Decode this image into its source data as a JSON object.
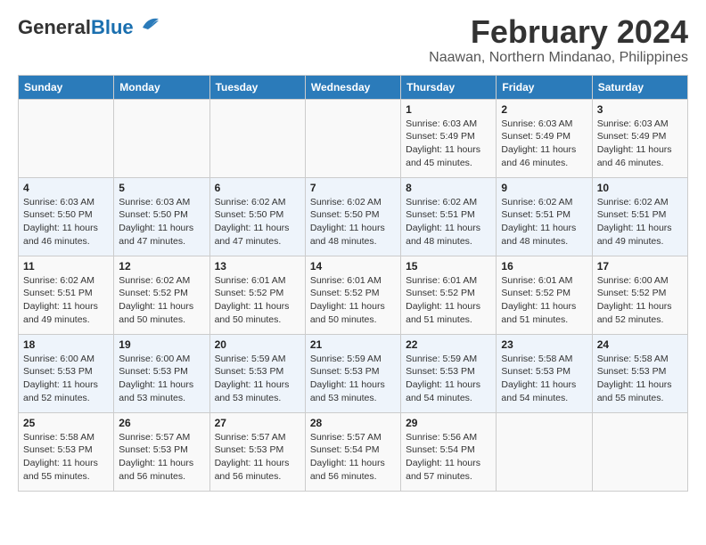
{
  "header": {
    "logo_general": "General",
    "logo_blue": "Blue",
    "month_title": "February 2024",
    "location": "Naawan, Northern Mindanao, Philippines"
  },
  "days_of_week": [
    "Sunday",
    "Monday",
    "Tuesday",
    "Wednesday",
    "Thursday",
    "Friday",
    "Saturday"
  ],
  "weeks": [
    [
      {
        "day": "",
        "info": ""
      },
      {
        "day": "",
        "info": ""
      },
      {
        "day": "",
        "info": ""
      },
      {
        "day": "",
        "info": ""
      },
      {
        "day": "1",
        "info": "Sunrise: 6:03 AM\nSunset: 5:49 PM\nDaylight: 11 hours and 45 minutes."
      },
      {
        "day": "2",
        "info": "Sunrise: 6:03 AM\nSunset: 5:49 PM\nDaylight: 11 hours and 46 minutes."
      },
      {
        "day": "3",
        "info": "Sunrise: 6:03 AM\nSunset: 5:49 PM\nDaylight: 11 hours and 46 minutes."
      }
    ],
    [
      {
        "day": "4",
        "info": "Sunrise: 6:03 AM\nSunset: 5:50 PM\nDaylight: 11 hours and 46 minutes."
      },
      {
        "day": "5",
        "info": "Sunrise: 6:03 AM\nSunset: 5:50 PM\nDaylight: 11 hours and 47 minutes."
      },
      {
        "day": "6",
        "info": "Sunrise: 6:02 AM\nSunset: 5:50 PM\nDaylight: 11 hours and 47 minutes."
      },
      {
        "day": "7",
        "info": "Sunrise: 6:02 AM\nSunset: 5:50 PM\nDaylight: 11 hours and 48 minutes."
      },
      {
        "day": "8",
        "info": "Sunrise: 6:02 AM\nSunset: 5:51 PM\nDaylight: 11 hours and 48 minutes."
      },
      {
        "day": "9",
        "info": "Sunrise: 6:02 AM\nSunset: 5:51 PM\nDaylight: 11 hours and 48 minutes."
      },
      {
        "day": "10",
        "info": "Sunrise: 6:02 AM\nSunset: 5:51 PM\nDaylight: 11 hours and 49 minutes."
      }
    ],
    [
      {
        "day": "11",
        "info": "Sunrise: 6:02 AM\nSunset: 5:51 PM\nDaylight: 11 hours and 49 minutes."
      },
      {
        "day": "12",
        "info": "Sunrise: 6:02 AM\nSunset: 5:52 PM\nDaylight: 11 hours and 50 minutes."
      },
      {
        "day": "13",
        "info": "Sunrise: 6:01 AM\nSunset: 5:52 PM\nDaylight: 11 hours and 50 minutes."
      },
      {
        "day": "14",
        "info": "Sunrise: 6:01 AM\nSunset: 5:52 PM\nDaylight: 11 hours and 50 minutes."
      },
      {
        "day": "15",
        "info": "Sunrise: 6:01 AM\nSunset: 5:52 PM\nDaylight: 11 hours and 51 minutes."
      },
      {
        "day": "16",
        "info": "Sunrise: 6:01 AM\nSunset: 5:52 PM\nDaylight: 11 hours and 51 minutes."
      },
      {
        "day": "17",
        "info": "Sunrise: 6:00 AM\nSunset: 5:52 PM\nDaylight: 11 hours and 52 minutes."
      }
    ],
    [
      {
        "day": "18",
        "info": "Sunrise: 6:00 AM\nSunset: 5:53 PM\nDaylight: 11 hours and 52 minutes."
      },
      {
        "day": "19",
        "info": "Sunrise: 6:00 AM\nSunset: 5:53 PM\nDaylight: 11 hours and 53 minutes."
      },
      {
        "day": "20",
        "info": "Sunrise: 5:59 AM\nSunset: 5:53 PM\nDaylight: 11 hours and 53 minutes."
      },
      {
        "day": "21",
        "info": "Sunrise: 5:59 AM\nSunset: 5:53 PM\nDaylight: 11 hours and 53 minutes."
      },
      {
        "day": "22",
        "info": "Sunrise: 5:59 AM\nSunset: 5:53 PM\nDaylight: 11 hours and 54 minutes."
      },
      {
        "day": "23",
        "info": "Sunrise: 5:58 AM\nSunset: 5:53 PM\nDaylight: 11 hours and 54 minutes."
      },
      {
        "day": "24",
        "info": "Sunrise: 5:58 AM\nSunset: 5:53 PM\nDaylight: 11 hours and 55 minutes."
      }
    ],
    [
      {
        "day": "25",
        "info": "Sunrise: 5:58 AM\nSunset: 5:53 PM\nDaylight: 11 hours and 55 minutes."
      },
      {
        "day": "26",
        "info": "Sunrise: 5:57 AM\nSunset: 5:53 PM\nDaylight: 11 hours and 56 minutes."
      },
      {
        "day": "27",
        "info": "Sunrise: 5:57 AM\nSunset: 5:53 PM\nDaylight: 11 hours and 56 minutes."
      },
      {
        "day": "28",
        "info": "Sunrise: 5:57 AM\nSunset: 5:54 PM\nDaylight: 11 hours and 56 minutes."
      },
      {
        "day": "29",
        "info": "Sunrise: 5:56 AM\nSunset: 5:54 PM\nDaylight: 11 hours and 57 minutes."
      },
      {
        "day": "",
        "info": ""
      },
      {
        "day": "",
        "info": ""
      }
    ]
  ]
}
